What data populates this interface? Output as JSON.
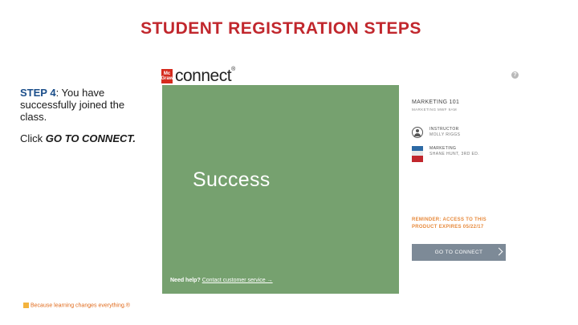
{
  "slide": {
    "title": "STUDENT REGISTRATION STEPS"
  },
  "instructions": {
    "step_label": "STEP 4",
    "step_text": ": You have successfully joined the class.",
    "click_prefix": "Click ",
    "click_target": "GO TO CONNECT."
  },
  "app": {
    "brand_top": "Mc",
    "brand_bottom": "Graw",
    "logo_text": "connect",
    "logo_mark": "®",
    "help_icon": "?"
  },
  "success": {
    "heading": "Success",
    "need_help": "Need help?",
    "support_link": "Contact customer service →"
  },
  "course": {
    "name": "MARKETING 101",
    "section": "MARKETING MWF 9AM",
    "instructor_label": "INSTRUCTOR",
    "instructor_name": "MOLLY RIGGS",
    "book_title": "MARKETING",
    "book_author": "SHANE HUNT, 3RD ED."
  },
  "reminder": "REMINDER: ACCESS TO THIS PRODUCT EXPIRES 05/22/17",
  "go_button": "GO TO CONNECT",
  "footer": {
    "tagline": "Because learning changes everything.®"
  },
  "colors": {
    "title": "#c1272d",
    "step_label": "#1b4e8a",
    "success_panel": "#76a16f",
    "reminder": "#e7893b",
    "button": "#7d8a97"
  },
  "icons": [
    "mcgraw-hill-logo-icon",
    "help-icon",
    "instructor-avatar-icon",
    "book-cover-icon",
    "chevron-right-icon"
  ]
}
